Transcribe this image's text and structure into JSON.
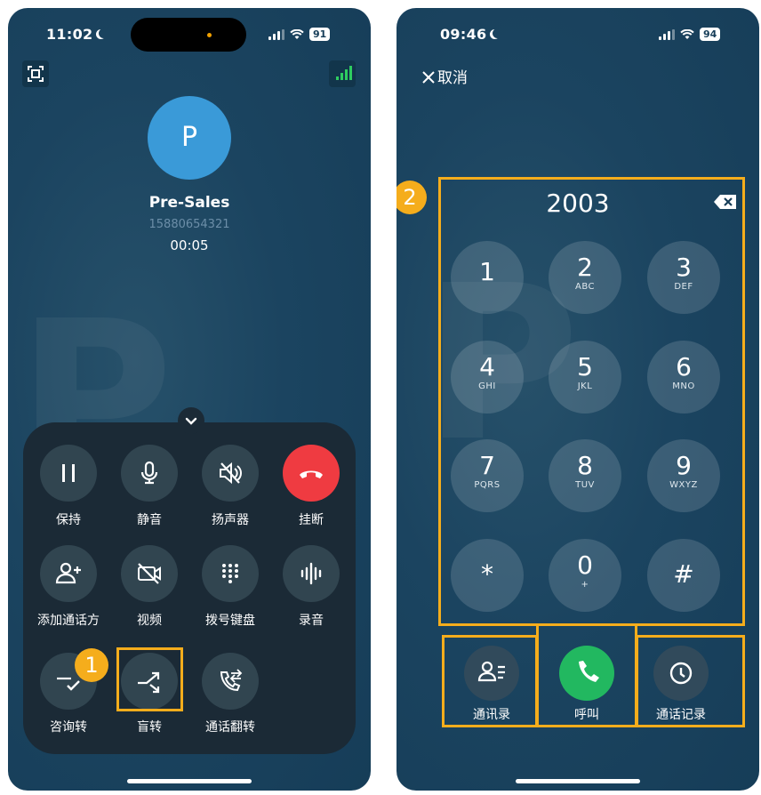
{
  "left": {
    "status": {
      "time": "11:02",
      "battery": "91"
    },
    "contact": {
      "initial": "P",
      "name": "Pre-Sales",
      "number": "15880654321",
      "duration": "00:05"
    },
    "controls": [
      {
        "label": "保持"
      },
      {
        "label": "静音"
      },
      {
        "label": "扬声器"
      },
      {
        "label": "挂断"
      },
      {
        "label": "添加通话方"
      },
      {
        "label": "视频"
      },
      {
        "label": "拨号键盘"
      },
      {
        "label": "录音"
      },
      {
        "label": "咨询转"
      },
      {
        "label": "盲转"
      },
      {
        "label": "通话翻转"
      }
    ],
    "callout": "1"
  },
  "right": {
    "status": {
      "time": "09:46",
      "battery": "94"
    },
    "cancel": "取消",
    "dialed": "2003",
    "keys": [
      {
        "n": "1",
        "s": ""
      },
      {
        "n": "2",
        "s": "ABC"
      },
      {
        "n": "3",
        "s": "DEF"
      },
      {
        "n": "4",
        "s": "GHI"
      },
      {
        "n": "5",
        "s": "JKL"
      },
      {
        "n": "6",
        "s": "MNO"
      },
      {
        "n": "7",
        "s": "PQRS"
      },
      {
        "n": "8",
        "s": "TUV"
      },
      {
        "n": "9",
        "s": "WXYZ"
      },
      {
        "n": "*",
        "s": ""
      },
      {
        "n": "0",
        "s": "+"
      },
      {
        "n": "#",
        "s": ""
      }
    ],
    "actions": {
      "contacts": "通讯录",
      "call": "呼叫",
      "history": "通话记录"
    },
    "callout": "2"
  },
  "colors": {
    "highlight": "#f5ad1c",
    "hangup": "#ef3b41",
    "call": "#22b860",
    "accent": "#3a9ad8"
  }
}
